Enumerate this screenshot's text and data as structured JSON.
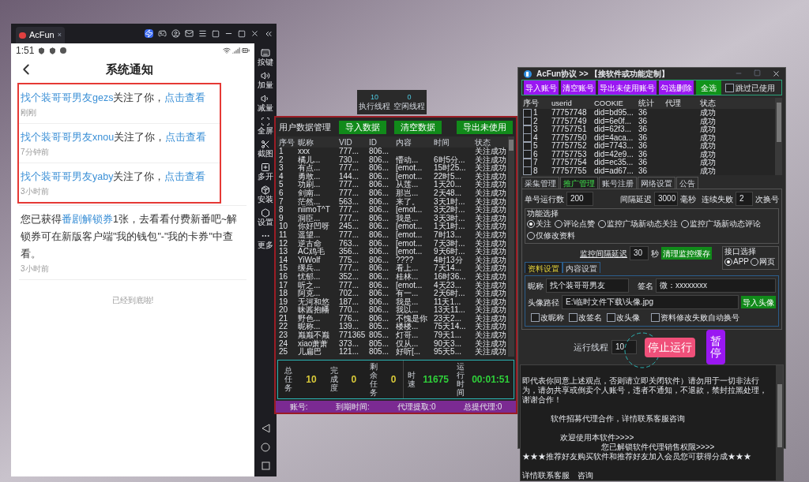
{
  "emulator": {
    "tab": {
      "label": "AcFun",
      "close": "×"
    },
    "status_time": "1:51",
    "page_title": "系统通知",
    "notification_groups": [
      {
        "highlighted": true,
        "items": [
          {
            "parts": [
              {
                "text": "找个装哥哥男友gezs",
                "link": true
              },
              {
                "text": "关注了你，",
                "link": false
              },
              {
                "text": "点击查看",
                "link": true
              }
            ],
            "time": "刚刚"
          },
          {
            "parts": [
              {
                "text": "找个装哥哥男友xnou",
                "link": true
              },
              {
                "text": "关注了你，",
                "link": false
              },
              {
                "text": "点击查看",
                "link": true
              }
            ],
            "time": "7分钟前"
          },
          {
            "parts": [
              {
                "text": "找个装哥哥男友yaby",
                "link": true
              },
              {
                "text": "关注了你，",
                "link": false
              },
              {
                "text": "点击查看",
                "link": true
              }
            ],
            "time": "3小时前"
          }
        ]
      },
      {
        "highlighted": false,
        "items": [
          {
            "parts": [
              {
                "text": "您已获得",
                "link": false
              },
              {
                "text": "番剧解锁券",
                "link": true
              },
              {
                "text": "1张，去看看付费新番吧~解锁券可在新版客户端\"我的钱包\"-\"我的卡券\"中查看。",
                "link": false
              }
            ],
            "time": "3小时前"
          }
        ]
      }
    ],
    "end_text": "已经到底啦!",
    "sidebar": [
      {
        "label": "按键",
        "kind": "keyboard"
      },
      {
        "label": "加量",
        "kind": "volume_up"
      },
      {
        "label": "减量",
        "kind": "volume_down"
      },
      {
        "label": "全屏",
        "kind": "fullscreen"
      },
      {
        "label": "截图",
        "kind": "scissors"
      },
      {
        "label": "多开",
        "kind": "multi"
      },
      {
        "label": "安装",
        "kind": "apk"
      },
      {
        "label": "设置",
        "kind": "settings"
      },
      {
        "label": "更多",
        "kind": "more"
      }
    ]
  },
  "thread_monitor": [
    {
      "value": "10",
      "label": "执行线程"
    },
    {
      "value": "0",
      "label": "空闲线程"
    }
  ],
  "data_panel": {
    "title": "用户数据管理",
    "buttons": [
      "导入数据",
      "清空数据",
      "导出未使用"
    ],
    "columns": [
      "序号",
      "昵称",
      "VID",
      "ID",
      "内容",
      "时间",
      "状态"
    ],
    "rows": [
      {
        "no": "1",
        "nick": "xxx",
        "vid": "777...",
        "id": "806...",
        "status": "关注成功"
      },
      {
        "no": "2",
        "nick": "橘儿...",
        "vid": "730...",
        "id": "806...",
        "content": "懵动...",
        "time": "6时5分...",
        "status": "关注成功"
      },
      {
        "no": "3",
        "nick": "有点...",
        "vid": "777...",
        "id": "806...",
        "content": "[emot...",
        "time": "15时25...",
        "status": "关注成功"
      },
      {
        "no": "4",
        "nick": "勇敢...",
        "vid": "144...",
        "id": "806...",
        "content": "[emot...",
        "time": "22时5...",
        "status": "关注成功"
      },
      {
        "no": "5",
        "nick": "功刷...",
        "vid": "777...",
        "id": "806...",
        "content": "从莲...",
        "time": "1天20...",
        "status": "关注成功"
      },
      {
        "no": "6",
        "nick": "剑南...",
        "vid": "777...",
        "id": "806...",
        "content": "那岂...",
        "time": "2天48...",
        "status": "关注成功"
      },
      {
        "no": "7",
        "nick": "茫然...",
        "vid": "563...",
        "id": "806...",
        "content": "来了。",
        "time": "3天1时...",
        "status": "关注成功"
      },
      {
        "no": "8",
        "nick": "niimoT^T",
        "vid": "777...",
        "id": "806...",
        "content": "[emot...",
        "time": "3天2时...",
        "status": "关注成功"
      },
      {
        "no": "9",
        "nick": "洞臣...",
        "vid": "777...",
        "id": "806...",
        "content": "我是...",
        "time": "3天3时...",
        "status": "关注成功"
      },
      {
        "no": "10",
        "nick": "你好凹呀",
        "vid": "245...",
        "id": "806...",
        "content": "[emot...",
        "time": "1天1时...",
        "status": "关注成功"
      },
      {
        "no": "11",
        "nick": "遥望...",
        "vid": "777...",
        "id": "806...",
        "content": "[emot...",
        "time": "7时13...",
        "status": "关注成功"
      },
      {
        "no": "12",
        "nick": "逆古命",
        "vid": "763...",
        "id": "806...",
        "content": "[emot...",
        "time": "7天3时...",
        "status": "关注成功"
      },
      {
        "no": "13",
        "nick": "AC鸡毛",
        "vid": "356...",
        "id": "806...",
        "content": "[emot...",
        "time": "9天6时...",
        "status": "关注成功"
      },
      {
        "no": "14",
        "nick": "YiWolf",
        "vid": "775...",
        "id": "806...",
        "content": "????",
        "time": "4时13分",
        "status": "关注成功"
      },
      {
        "no": "15",
        "nick": "缓兵...",
        "vid": "777...",
        "id": "806...",
        "content": "看上...",
        "time": "7天14...",
        "status": "关注成功"
      },
      {
        "no": "16",
        "nick": "忧郁...",
        "vid": "352...",
        "id": "806...",
        "content": "桂林...",
        "time": "16时36...",
        "status": "关注成功"
      },
      {
        "no": "17",
        "nick": "听之...",
        "vid": "777...",
        "id": "806...",
        "content": "[emot...",
        "time": "4天23...",
        "status": "关注成功"
      },
      {
        "no": "18",
        "nick": "阿克...",
        "vid": "702...",
        "id": "806...",
        "content": "有一...",
        "time": "2天6时...",
        "status": "关注成功"
      },
      {
        "no": "19",
        "nick": "无河和悠",
        "vid": "187...",
        "id": "806...",
        "content": "我是...",
        "time": "11天1...",
        "status": "关注成功"
      },
      {
        "no": "20",
        "nick": "昧酱抱幡",
        "vid": "770...",
        "id": "806...",
        "content": "我以...",
        "time": "13天11...",
        "status": "关注成功"
      },
      {
        "no": "21",
        "nick": "野色...",
        "vid": "776...",
        "id": "806...",
        "content": "不愧是你",
        "time": "23天2...",
        "status": "关注成功"
      },
      {
        "no": "22",
        "nick": "昵称...",
        "vid": "139...",
        "id": "805...",
        "content": "楼楼...",
        "time": "75天14...",
        "status": "关注成功"
      },
      {
        "no": "23",
        "nick": "巅巅不巅",
        "vid": "771365",
        "id": "805...",
        "content": "灯哥...",
        "time": "79天1...",
        "status": "关注成功"
      },
      {
        "no": "24",
        "nick": "xiao萧萧",
        "vid": "373...",
        "id": "805...",
        "content": "仅从...",
        "time": "90天3...",
        "status": "关注成功"
      },
      {
        "no": "25",
        "nick": "儿扁巴",
        "vid": "121...",
        "id": "805...",
        "content": "好听[...",
        "time": "95天5...",
        "status": "关注成功"
      }
    ],
    "stats": [
      {
        "label": "总任务",
        "value": "10",
        "color": "#d8c93a"
      },
      {
        "label": "完成度",
        "value": "0",
        "color": "#d8c93a"
      },
      {
        "label": "剩余任务",
        "value": "0",
        "color": "#d8c93a"
      }
    ],
    "speed_stats": [
      {
        "label": "时速",
        "value": "11675",
        "color": "#2fcf3a"
      },
      {
        "label": "运行时间",
        "value": "00:01:51",
        "color": "#2fcf3a"
      }
    ],
    "status_bar": [
      "账号:",
      "到期时间:",
      "代理提取:0",
      "总提代理:0"
    ]
  },
  "protocol_window": {
    "title": "AcFun协议 >> 【接软件或功能定制】",
    "actions": [
      {
        "label": "导入账号",
        "color": "#9a17f2"
      },
      {
        "label": "清空账号",
        "color": "#9a17f2"
      },
      {
        "label": "导出未使用账号",
        "color": "#9a17f2"
      },
      {
        "label": "勾选删除",
        "color": "#9a17f2"
      },
      {
        "label": "全选",
        "color": "#11941a"
      }
    ],
    "skip_used": {
      "label": "跳过已使用",
      "checked": false
    },
    "account_columns": [
      "序号",
      "userid",
      "COOKIE",
      "统计",
      "代理",
      "状态"
    ],
    "accounts": [
      {
        "checked": false,
        "no": "1",
        "userid": "77757748",
        "cookie": "did=bd95...",
        "count": "36",
        "status": "成功"
      },
      {
        "checked": false,
        "no": "2",
        "userid": "77757749",
        "cookie": "did=6e0f...",
        "count": "36",
        "status": "成功"
      },
      {
        "checked": false,
        "no": "3",
        "userid": "77757751",
        "cookie": "did=62f3...",
        "count": "36",
        "status": "成功"
      },
      {
        "checked": false,
        "no": "4",
        "userid": "77757750",
        "cookie": "did=4aca...",
        "count": "36",
        "status": "成功"
      },
      {
        "checked": false,
        "no": "5",
        "userid": "77757752",
        "cookie": "did=7743...",
        "count": "36",
        "status": "成功"
      },
      {
        "checked": false,
        "no": "6",
        "userid": "77757753",
        "cookie": "did=42e9...",
        "count": "36",
        "status": "成功"
      },
      {
        "checked": false,
        "no": "7",
        "userid": "77757754",
        "cookie": "did=ec35...",
        "count": "36",
        "status": "成功"
      },
      {
        "checked": false,
        "no": "8",
        "userid": "77757755",
        "cookie": "did=ad67...",
        "count": "36",
        "status": "成功"
      }
    ],
    "tabs": [
      {
        "label": "采集管理",
        "selected": false
      },
      {
        "label": "推广管理",
        "selected": true
      },
      {
        "label": "账号注册",
        "selected": false
      },
      {
        "label": "网络设置",
        "selected": false
      },
      {
        "label": "公告",
        "selected": false
      }
    ],
    "run_count": {
      "label": "单号运行数",
      "value": "200"
    },
    "interval": {
      "label": "间隔延迟",
      "value": "3000",
      "unit": "毫秒"
    },
    "fail_switch": {
      "label": "连续失败",
      "value": "2",
      "unit": "次换号"
    },
    "function_group": {
      "title": "功能选择",
      "options": [
        {
          "label": "关注",
          "selected": true
        },
        {
          "label": "评论点赞",
          "selected": false
        },
        {
          "label": "监控广场新动态关注",
          "selected": false
        },
        {
          "label": "监控广场新动态评论",
          "selected": false
        },
        {
          "label": "仅修改资料",
          "selected": false
        }
      ]
    },
    "monitor": {
      "label": "监控间隔延迟",
      "value": "30",
      "unit": "秒",
      "button": "清理监控缓存"
    },
    "api_group": {
      "title": "接口选择",
      "options": [
        {
          "label": "APP",
          "selected": true
        },
        {
          "label": "网页",
          "selected": false
        }
      ]
    },
    "subtabs": [
      {
        "label": "资料设置",
        "selected": true
      },
      {
        "label": "内容设置",
        "selected": false
      }
    ],
    "profile": {
      "nickname": {
        "label": "昵称",
        "value": "找个装哥哥男友"
      },
      "signature": {
        "label": "签名",
        "value": "微：xxxxxxxx"
      },
      "avatar": {
        "label": "头像路径",
        "value": "E:\\临时文件下载\\头像.jpg",
        "button": "导入头像"
      },
      "options": [
        {
          "label": "改昵称",
          "checked": false
        },
        {
          "label": "改签名",
          "checked": false
        },
        {
          "label": "改头像",
          "checked": false
        },
        {
          "label": "资料修改失败自动换号",
          "checked": false
        }
      ]
    },
    "run": {
      "label": "运行线程",
      "value": "10",
      "stop": "停止运行",
      "pause": "暂停"
    },
    "log": [
      {
        "kind": "plain",
        "text": "即代表你同意上述观点，否则请立即关闭软件）请勿用于一切非法行为，请勿共享或倒卖个人账号，违者不通知，不退款，禁封拉黑处理，谢谢合作！"
      },
      {
        "kind": "indent_small",
        "text": "软件招募代理合作，详情联系客服咨询"
      },
      {
        "kind": "indent_mid",
        "text": "欢迎使用本软件>>>>"
      },
      {
        "kind": "indent_wide",
        "text": "您已解锁软件代理销售权限>>>>"
      },
      {
        "kind": "plain_tight",
        "text": "★★★推荐好友购买软件和推荐好友加入会员您可获得分成★★★"
      },
      {
        "kind": "plain",
        "text": "详情联系客服　咨询"
      }
    ]
  }
}
